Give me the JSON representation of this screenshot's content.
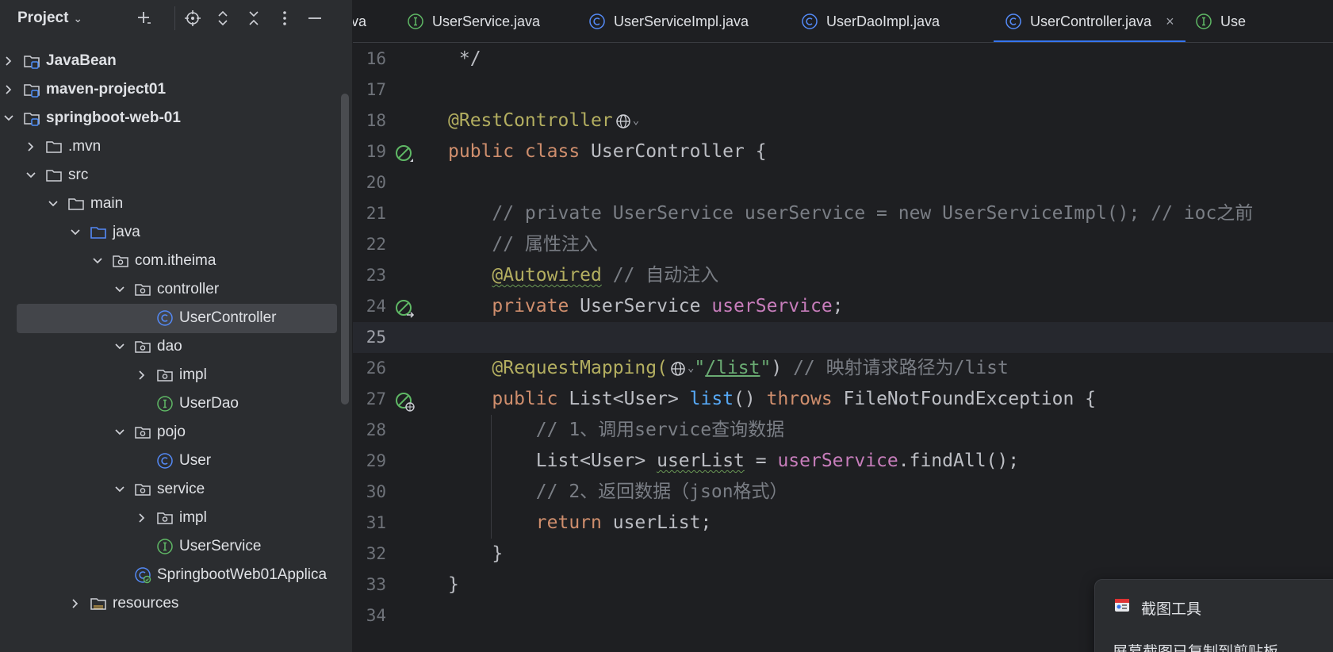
{
  "project_panel": {
    "title": "Project",
    "tree": [
      {
        "label": "JavaBean",
        "icon": "module-folder-icon",
        "expanded": false,
        "bold": true
      },
      {
        "label": "maven-project01",
        "icon": "module-folder-icon",
        "expanded": false,
        "bold": true
      },
      {
        "label": "springboot-web-01",
        "icon": "module-folder-icon",
        "expanded": true,
        "bold": true
      },
      {
        "label": ".mvn",
        "icon": "folder-icon",
        "expanded": false
      },
      {
        "label": "src",
        "icon": "folder-icon",
        "expanded": true
      },
      {
        "label": "main",
        "icon": "folder-icon",
        "expanded": true
      },
      {
        "label": "java",
        "icon": "source-folder-icon",
        "expanded": true
      },
      {
        "label": "com.itheima",
        "icon": "package-icon",
        "expanded": true
      },
      {
        "label": "controller",
        "icon": "package-icon",
        "expanded": true
      },
      {
        "label": "UserController",
        "icon": "class-icon",
        "selected": true
      },
      {
        "label": "dao",
        "icon": "package-icon",
        "expanded": true
      },
      {
        "label": "impl",
        "icon": "package-icon",
        "expanded": false
      },
      {
        "label": "UserDao",
        "icon": "interface-icon"
      },
      {
        "label": "pojo",
        "icon": "package-icon",
        "expanded": true
      },
      {
        "label": "User",
        "icon": "class-icon"
      },
      {
        "label": "service",
        "icon": "package-icon",
        "expanded": true
      },
      {
        "label": "impl",
        "icon": "package-icon",
        "expanded": false
      },
      {
        "label": "UserService",
        "icon": "interface-icon"
      },
      {
        "label": "SpringbootWeb01Applica",
        "icon": "spring-boot-class-icon"
      },
      {
        "label": "resources",
        "icon": "resources-folder-icon",
        "expanded": false
      }
    ]
  },
  "tabs": [
    {
      "label": "ava",
      "icon": "none"
    },
    {
      "label": "UserService.java",
      "icon": "interface-icon"
    },
    {
      "label": "UserServiceImpl.java",
      "icon": "class-icon"
    },
    {
      "label": "UserDaoImpl.java",
      "icon": "class-icon"
    },
    {
      "label": "UserController.java",
      "icon": "class-icon",
      "active": true,
      "close": "×"
    },
    {
      "label": "Use",
      "icon": "interface-icon"
    }
  ],
  "editor": {
    "current_line": "25",
    "lines": [
      {
        "n": "16",
        "text": " */"
      },
      {
        "n": "17",
        "text": ""
      },
      {
        "n": "18",
        "a": "@RestController"
      },
      {
        "n": "19",
        "k1": "public class ",
        "t": "UserController {"
      },
      {
        "n": "20",
        "text": ""
      },
      {
        "n": "21",
        "cm": "    // private UserService userService = new UserServiceImpl(); // ioc之前"
      },
      {
        "n": "22",
        "cm": "    // 属性注入"
      },
      {
        "n": "23",
        "pre": "    ",
        "a": "@Autowired",
        "cm": " // 自动注入"
      },
      {
        "n": "24",
        "pre": "    ",
        "k1": "private ",
        "t": "UserService ",
        "f": "userService",
        "post": ";"
      },
      {
        "n": "25",
        "text": ""
      },
      {
        "n": "26",
        "pre": "    ",
        "a": "@RequestMapping(",
        "s1": "\"",
        "s2": "/list",
        "s3": "\"",
        "post": ")",
        "cm": " // 映射请求路径为/list"
      },
      {
        "n": "27",
        "pre": "    ",
        "k1": "public ",
        "t": "List<User> ",
        "fn": "list",
        "t2": "() ",
        "k2": "throws ",
        "t3": "FileNotFoundException {"
      },
      {
        "n": "28",
        "cm": "        // 1、调用service查询数据"
      },
      {
        "n": "29",
        "pre": "        ",
        "t": "List<User> ",
        "u": "userList",
        "t2": " = ",
        "f": "userService",
        "post": ".findAll();"
      },
      {
        "n": "30",
        "cm": "        // 2、返回数据（json格式）"
      },
      {
        "n": "31",
        "pre": "        ",
        "k1": "return ",
        "t": "userList;"
      },
      {
        "n": "32",
        "text": "    }"
      },
      {
        "n": "33",
        "text": "}"
      },
      {
        "n": "34",
        "text": ""
      }
    ]
  },
  "popup": {
    "title": "截图工具",
    "body": "屏幕截图已复制到剪贴板"
  },
  "colors": {
    "keyword": "#cf8e6d",
    "annotation": "#b3ae60",
    "comment": "#7a7e85",
    "field": "#c77dbb",
    "string": "#6aab73",
    "method": "#56a8f5",
    "accent": "#3574f0"
  }
}
